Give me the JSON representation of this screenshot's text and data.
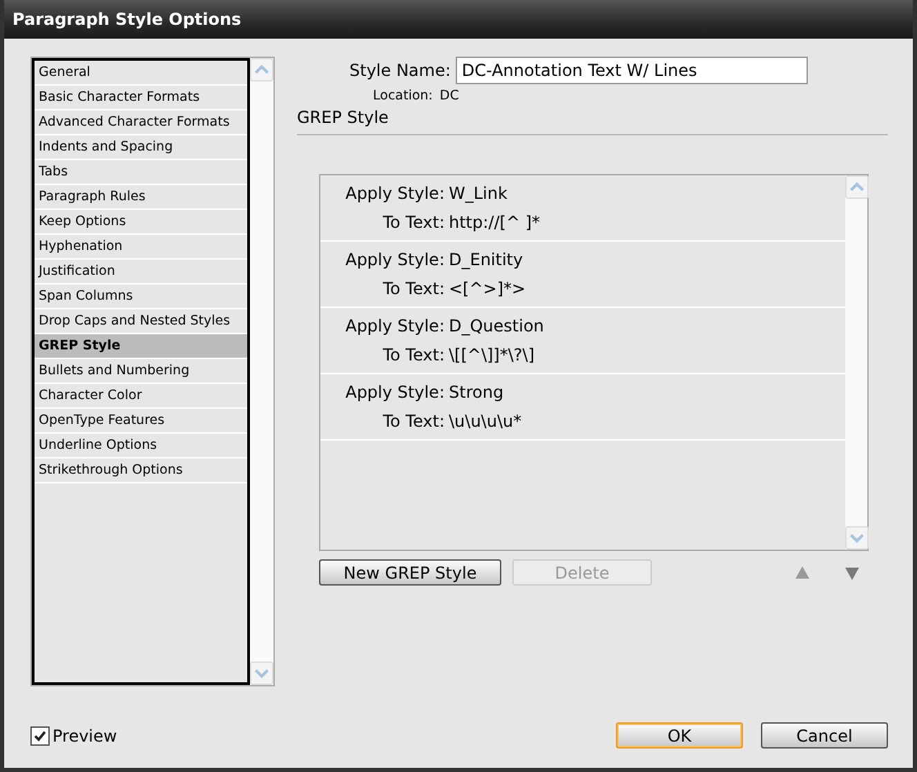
{
  "window": {
    "title": "Paragraph Style Options"
  },
  "categories": [
    {
      "label": "General",
      "selected": false
    },
    {
      "label": "Basic Character Formats",
      "selected": false
    },
    {
      "label": "Advanced Character Formats",
      "selected": false
    },
    {
      "label": "Indents and Spacing",
      "selected": false
    },
    {
      "label": "Tabs",
      "selected": false
    },
    {
      "label": "Paragraph Rules",
      "selected": false
    },
    {
      "label": "Keep Options",
      "selected": false
    },
    {
      "label": "Hyphenation",
      "selected": false
    },
    {
      "label": "Justification",
      "selected": false
    },
    {
      "label": "Span Columns",
      "selected": false
    },
    {
      "label": "Drop Caps and Nested Styles",
      "selected": false
    },
    {
      "label": "GREP Style",
      "selected": true
    },
    {
      "label": "Bullets and Numbering",
      "selected": false
    },
    {
      "label": "Character Color",
      "selected": false
    },
    {
      "label": "OpenType Features",
      "selected": false
    },
    {
      "label": "Underline Options",
      "selected": false
    },
    {
      "label": "Strikethrough Options",
      "selected": false
    }
  ],
  "style_name": {
    "label": "Style Name:",
    "value": "DC-Annotation Text W/ Lines"
  },
  "location": {
    "label": "Location:",
    "value": "DC"
  },
  "section_title": "GREP Style",
  "grep_styles": [
    {
      "apply_label": "Apply Style:",
      "style": "W_Link",
      "text_label": "To Text:",
      "expression": "http://[^ ]*"
    },
    {
      "apply_label": "Apply Style:",
      "style": "D_Enitity",
      "text_label": "To Text:",
      "expression": "<[^>]*>"
    },
    {
      "apply_label": "Apply Style:",
      "style": "D_Question",
      "text_label": "To Text:",
      "expression": "\\[[^\\]]*\\?\\]"
    },
    {
      "apply_label": "Apply Style:",
      "style": "Strong",
      "text_label": "To Text:",
      "expression": "\\u\\u\\u\\u*"
    }
  ],
  "list_buttons": [
    {
      "label": "New GREP Style",
      "disabled": false
    },
    {
      "label": "Delete",
      "disabled": true
    }
  ],
  "preview": {
    "label": "Preview",
    "checked": true
  },
  "actions": [
    {
      "label": "OK",
      "default": true
    },
    {
      "label": "Cancel",
      "default": false
    }
  ]
}
